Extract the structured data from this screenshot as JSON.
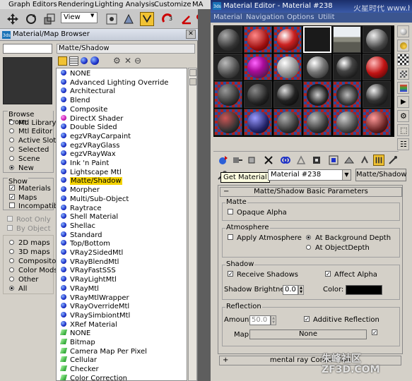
{
  "menubar": {
    "items": [
      "Graph Editors",
      "Rendering",
      "Lighting Analysis",
      "Customize",
      "MA"
    ]
  },
  "toolbar": {
    "view_select": "View"
  },
  "browser": {
    "title": "Material/Map Browser",
    "name_field": "Matte/Shadow",
    "browse_from": {
      "title": "Browse From:",
      "options": [
        "Mtl Library",
        "Mtl Editor",
        "Active Slot",
        "Selected",
        "Scene",
        "New"
      ],
      "selected": "New"
    },
    "show": {
      "title": "Show",
      "materials": "Materials",
      "maps": "Maps",
      "incompatible": "Incompatible"
    },
    "root_only": "Root Only",
    "by_object": "By Object",
    "map_filter": {
      "options": [
        "2D maps",
        "3D maps",
        "Compositors",
        "Color Mods",
        "Other",
        "All"
      ],
      "selected": "All"
    },
    "list": [
      {
        "label": "NONE",
        "kind": "mtl"
      },
      {
        "label": "Advanced Lighting Override",
        "kind": "mtl"
      },
      {
        "label": "Architectural",
        "kind": "mtl"
      },
      {
        "label": "Blend",
        "kind": "mtl"
      },
      {
        "label": "Composite",
        "kind": "mtl"
      },
      {
        "label": "DirectX Shader",
        "kind": "dx"
      },
      {
        "label": "Double Sided",
        "kind": "mtl"
      },
      {
        "label": "egzVRayCarpaint",
        "kind": "mtl"
      },
      {
        "label": "egzVRayGlass",
        "kind": "mtl"
      },
      {
        "label": "egzVRayWax",
        "kind": "mtl"
      },
      {
        "label": "Ink 'n Paint",
        "kind": "mtl"
      },
      {
        "label": "Lightscape Mtl",
        "kind": "mtl"
      },
      {
        "label": "Matte/Shadow",
        "kind": "mtl",
        "selected": true
      },
      {
        "label": "Morpher",
        "kind": "mtl"
      },
      {
        "label": "Multi/Sub-Object",
        "kind": "mtl"
      },
      {
        "label": "Raytrace",
        "kind": "mtl"
      },
      {
        "label": "Shell Material",
        "kind": "mtl"
      },
      {
        "label": "Shellac",
        "kind": "mtl"
      },
      {
        "label": "Standard",
        "kind": "mtl"
      },
      {
        "label": "Top/Bottom",
        "kind": "mtl"
      },
      {
        "label": "VRay2SidedMtl",
        "kind": "mtl"
      },
      {
        "label": "VRayBlendMtl",
        "kind": "mtl"
      },
      {
        "label": "VRayFastSSS",
        "kind": "mtl"
      },
      {
        "label": "VRayLightMtl",
        "kind": "mtl"
      },
      {
        "label": "VRayMtl",
        "kind": "mtl"
      },
      {
        "label": "VRayMtlWrapper",
        "kind": "mtl"
      },
      {
        "label": "VRayOverrideMtl",
        "kind": "mtl"
      },
      {
        "label": "VRaySimbiontMtl",
        "kind": "mtl"
      },
      {
        "label": "XRef Material",
        "kind": "mtl"
      },
      {
        "label": "NONE",
        "kind": "map"
      },
      {
        "label": "Bitmap",
        "kind": "map"
      },
      {
        "label": "Camera Map Per Pixel",
        "kind": "map"
      },
      {
        "label": "Cellular",
        "kind": "map"
      },
      {
        "label": "Checker",
        "kind": "map"
      },
      {
        "label": "Color Correction",
        "kind": "map"
      }
    ]
  },
  "editor": {
    "title": "Material Editor - Material #238",
    "menu": [
      "Material",
      "Navigation",
      "Options",
      "Utilit"
    ],
    "tooltip": "Get Material",
    "material_name": "Material #238",
    "material_type": "Matte/Shadow",
    "rollout_title": "Matte/Shadow Basic Parameters",
    "matte": {
      "title": "Matte",
      "opaque_alpha": "Opaque Alpha"
    },
    "atmosphere": {
      "title": "Atmosphere",
      "apply_atmosphere": "Apply Atmosphere",
      "at_background_depth": "At Background Depth",
      "at_object_depth": "At ObjectDepth"
    },
    "shadow": {
      "title": "Shadow",
      "receive_shadows": "Receive Shadows",
      "affect_alpha": "Affect Alpha",
      "brightness_label": "Shadow Brightness:",
      "brightness_value": "0.0",
      "color_label": "Color:",
      "color": "#000000"
    },
    "reflection": {
      "title": "Reflection",
      "amount_label": "Amount:",
      "amount_value": "50.0",
      "additive_reflection": "Additive Reflection",
      "map_label": "Map:",
      "map_value": "None"
    },
    "bottom_rollout": "mental ray Connection"
  },
  "watermark": {
    "top": "火星时代 www.hxsd.com",
    "bottom": "朱峰社区 ZF3D.COM"
  }
}
